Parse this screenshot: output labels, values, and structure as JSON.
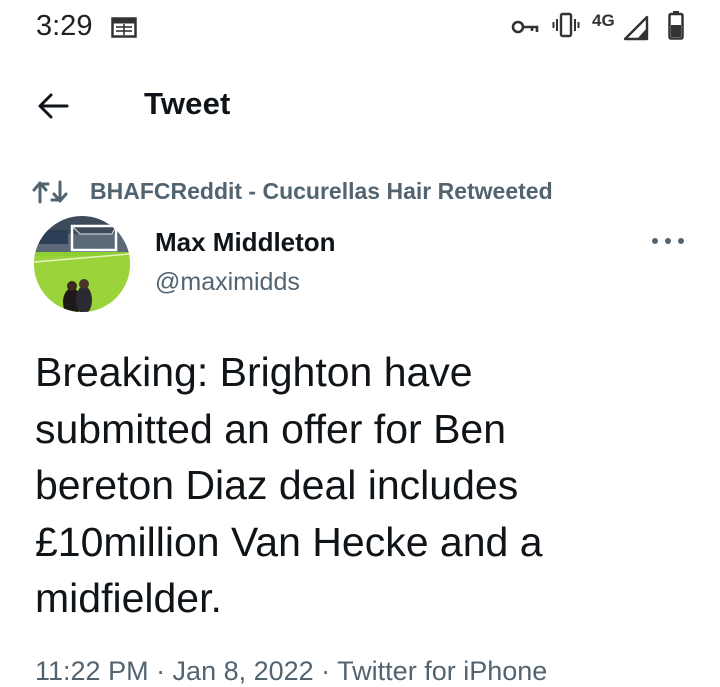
{
  "status_bar": {
    "time": "3:29",
    "network": "4G",
    "icons": [
      "calendar-icon",
      "vpn-key-icon",
      "vibrate-icon",
      "signal-icon",
      "battery-icon"
    ]
  },
  "header": {
    "back_icon": "back-arrow-icon",
    "title": "Tweet"
  },
  "retweet": {
    "icon": "retweet-icon",
    "text": "BHAFCReddit - Cucurellas Hair Retweeted"
  },
  "tweet": {
    "author": {
      "name": "Max Middleton",
      "handle": "@maximidds",
      "avatar_icon": "avatar-photo"
    },
    "more_icon": "more-options-icon",
    "lines": [
      "Breaking: Brighton have",
      "submitted an offer for Ben",
      "bereton Diaz deal includes",
      "£10million Van Hecke and a",
      "midfielder."
    ],
    "meta": "11:22 PM · Jan 8, 2022 · Twitter for iPhone"
  },
  "colors": {
    "text": "#0f1419",
    "secondary": "#536471",
    "background": "#ffffff"
  }
}
